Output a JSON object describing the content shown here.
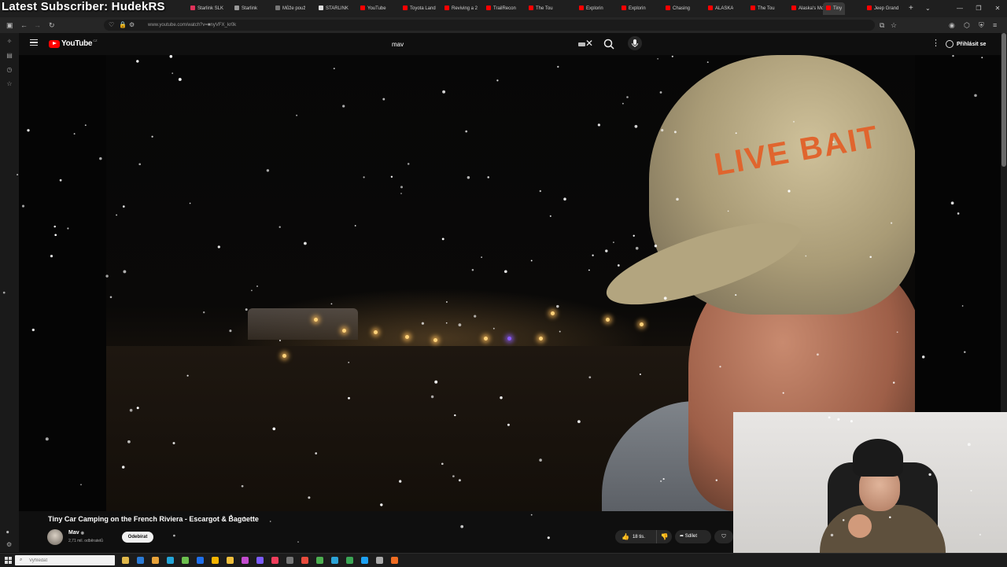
{
  "overlay_title": "Latest Subscriber: HudekRS",
  "browser": {
    "tabs": [
      {
        "label": "Starlink SLK",
        "color": "#e0325a"
      },
      {
        "label": "Starlink",
        "color": "#999999"
      },
      {
        "label": "Může použ",
        "color": "#777777"
      },
      {
        "label": "STARLINK",
        "color": "#dddddd"
      },
      {
        "label": "YouTube",
        "color": "#ff0000"
      },
      {
        "label": "Toyota Land",
        "color": "#ff0000"
      },
      {
        "label": "Reviving a 2",
        "color": "#ff0000"
      },
      {
        "label": "TrailRecon",
        "color": "#ff0000"
      },
      {
        "label": "The Tou",
        "color": "#ff0000"
      },
      {
        "label": "Explorin",
        "color": "#ff0000"
      },
      {
        "label": "Explorin",
        "color": "#ff0000"
      },
      {
        "label": "Chasing",
        "color": "#ff0000"
      },
      {
        "label": "ALASKA",
        "color": "#ff0000"
      },
      {
        "label": "The Tou",
        "color": "#ff0000"
      },
      {
        "label": "Alaska's Mo",
        "color": "#ff0000"
      },
      {
        "label": "Tiny",
        "color": "#ff0000",
        "active": true
      },
      {
        "label": "Jeep Grand",
        "color": "#ff0000"
      }
    ],
    "new_tab": "+",
    "tab_menu": "⌄",
    "url": "www.youtube.com/watch?v=■nyVFX_kr0k"
  },
  "youtube": {
    "logo_text": "YouTube",
    "logo_country": "CZ",
    "search_value": "mav",
    "signin_label": "Přihlásit se"
  },
  "video": {
    "title": "Tiny Car Camping on the French Riviera - Escargot & Baguette",
    "cap_text": "LIVE BAIT",
    "channel_name": "Mav",
    "channel_subs": "2,71 mil. odběratelů",
    "subscribe_label": "Odebírat",
    "likes": "18 tis.",
    "share_label": "Sdílet"
  },
  "taskbar": {
    "search_placeholder": "Vyhledat",
    "app_colors": [
      "#e0b84a",
      "#2b7bd6",
      "#e8a33a",
      "#23a5d8",
      "#6bbf4e",
      "#1f6feb",
      "#f4b400",
      "#f0c03c",
      "#c24ccf",
      "#7c5cff",
      "#ef3e5c",
      "#777777",
      "#e84c3d",
      "#4caf50",
      "#2ba3d6",
      "#3aa655",
      "#1da1f2",
      "#aaaaaa",
      "#ef6c22"
    ]
  },
  "colors": {
    "accent": "#ff0000",
    "background": "#0f0f0f"
  }
}
